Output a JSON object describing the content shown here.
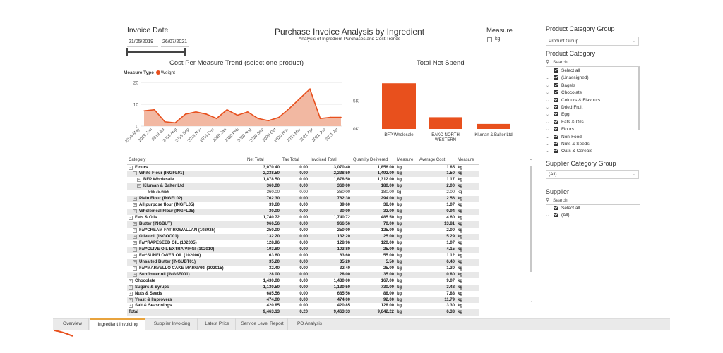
{
  "invoice_date": {
    "title": "Invoice Date",
    "start": "21/05/2019",
    "end": "26/07/2021"
  },
  "report": {
    "title": "Purchase Invoice Analysis by Ingredient",
    "subtitle": "Analysis of Ingredient Purchases and Cost Trends"
  },
  "measure": {
    "title": "Measure",
    "option": "kg"
  },
  "product_category_group": {
    "title": "Product Category Group",
    "selected": "Product Group"
  },
  "product_category": {
    "title": "Product Category",
    "search_placeholder": "Search",
    "select_all": "Select all",
    "items": [
      "(Unassigned)",
      "Bagels",
      "Chocolate",
      "Colours & Flavours",
      "Dried Fruit",
      "Egg",
      "Fats & Oils",
      "Flours",
      "Non-Food",
      "Nuts & Seeds",
      "Oats & Cereals"
    ]
  },
  "supplier_category_group": {
    "title": "Supplier Category Group",
    "selected": "(All)"
  },
  "supplier": {
    "title": "Supplier",
    "search_placeholder": "Search",
    "select_all": "Select all",
    "items": [
      "(All)"
    ]
  },
  "line_chart_meta": {
    "legend_label": "Measure Type",
    "legend_item": "Weight"
  },
  "chart_data": [
    {
      "type": "area",
      "title": "Cost Per Measure Trend (select one product)",
      "color": "#e8501d",
      "fill": "#f2b8a2",
      "ylim": [
        0,
        20
      ],
      "yticks": [
        "0",
        "10",
        "20"
      ],
      "x_labels": [
        "2019 May",
        "2019 Jun",
        "2019 Jul",
        "2019 Aug",
        "2019 Sep",
        "2019 Oct",
        "2019 Nov",
        "2019 Dec",
        "2020 Jan",
        "2020 Feb",
        "2020 Mar",
        "2020 Apr",
        "2020 May",
        "2020 Jun",
        "2020 Jul",
        "2020 Aug",
        "2020 Sep",
        "2020 Oct",
        "2020 Nov",
        "2020 Dec",
        "2021 Jan",
        "2021 Feb",
        "2021 Mar",
        "2021 Apr",
        "2021 May",
        "2021 Jun",
        "2021 Jul"
      ],
      "shown_tick_labels": [
        "2019 May",
        "2019 Jun",
        "2019 Jul",
        "2019 Aug",
        "2019 Sep",
        "2019 Nov",
        "2019 Dec",
        "2020 Jan",
        "2020 Feb",
        "2020 Aug",
        "2020 Sep",
        "2020 Oct",
        "2020 Nov",
        "2021 Mar",
        "2021 Apr",
        "2021 Jun",
        "2021 Jul"
      ],
      "values": [
        7,
        7.5,
        2,
        1.5,
        5.5,
        6.5,
        5.5,
        3.5,
        7.5,
        5,
        6.5,
        3.5,
        2.5,
        4,
        8,
        12.5,
        17,
        3.5,
        4,
        4
      ]
    },
    {
      "type": "bar",
      "title": "Total Net Spend",
      "color": "#e8501d",
      "categories": [
        "BFP Wholesale",
        "BAKO NORTH WESTERN",
        "Kluman & Balter Ltd"
      ],
      "values": [
        8.2,
        2.1,
        0.9
      ],
      "ylim": [
        0,
        10
      ],
      "yticks": [
        "0K",
        "5K"
      ],
      "category_lines": [
        [
          "BFP Wholesale"
        ],
        [
          "BAKO NORTH",
          "WESTERN"
        ],
        [
          "Kluman & Balter Ltd"
        ]
      ]
    }
  ],
  "table": {
    "headers": [
      "Category",
      "Net Total",
      "Tax Total",
      "Invoiced Total",
      "Quantity Delivered",
      "Measure",
      "Average Cost",
      "Measure"
    ],
    "rows": [
      {
        "level": 0,
        "box": "minus",
        "label": "Flours",
        "net": "3,070.40",
        "tax": "0.00",
        "inv": "3,070.40",
        "qty": "1,856.00",
        "m1": "kg",
        "avg": "1.85",
        "m2": "kg"
      },
      {
        "level": 1,
        "box": "minus",
        "label": "White Flour (INGFL01)",
        "net": "2,238.50",
        "tax": "0.00",
        "inv": "2,238.50",
        "qty": "1,492.00",
        "m1": "kg",
        "avg": "1.50",
        "m2": "kg"
      },
      {
        "level": 2,
        "box": "plus",
        "label": "BFP Wholesale",
        "net": "1,878.50",
        "tax": "0.00",
        "inv": "1,878.50",
        "qty": "1,312.00",
        "m1": "kg",
        "avg": "1.17",
        "m2": "kg"
      },
      {
        "level": 2,
        "box": "minus",
        "label": "Kluman & Balter Ltd",
        "net": "360.00",
        "tax": "0.00",
        "inv": "360.00",
        "qty": "180.00",
        "m1": "kg",
        "avg": "2.00",
        "m2": "kg"
      },
      {
        "level": 3,
        "box": "",
        "label": "565757656",
        "net": "360.00",
        "tax": "0.00",
        "inv": "360.00",
        "qty": "180.00",
        "m1": "kg",
        "avg": "2.00",
        "m2": "kg"
      },
      {
        "level": 1,
        "box": "plus",
        "label": "Plain Flour (INGFL02)",
        "net": "762.30",
        "tax": "0.00",
        "inv": "762.30",
        "qty": "294.00",
        "m1": "kg",
        "avg": "2.56",
        "m2": "kg"
      },
      {
        "level": 1,
        "box": "plus",
        "label": "All purpose flour (INGFL05)",
        "net": "39.60",
        "tax": "0.00",
        "inv": "39.60",
        "qty": "38.00",
        "m1": "kg",
        "avg": "1.07",
        "m2": "kg"
      },
      {
        "level": 1,
        "box": "plus",
        "label": "Wholemeal Flour (INGFL25)",
        "net": "30.00",
        "tax": "0.00",
        "inv": "30.00",
        "qty": "32.00",
        "m1": "kg",
        "avg": "0.94",
        "m2": "kg"
      },
      {
        "level": 0,
        "box": "minus",
        "label": "Fats & Oils",
        "net": "1,740.72",
        "tax": "0.00",
        "inv": "1,740.72",
        "qty": "485.50",
        "m1": "kg",
        "avg": "4.60",
        "m2": "kg"
      },
      {
        "level": 1,
        "box": "plus",
        "label": "Butter (INGBUT)",
        "net": "966.56",
        "tax": "0.00",
        "inv": "966.56",
        "qty": "70.00",
        "m1": "kg",
        "avg": "13.81",
        "m2": "kg"
      },
      {
        "level": 1,
        "box": "plus",
        "label": "Fat*CREAM FAT ROWALLAN (102025)",
        "net": "250.00",
        "tax": "0.00",
        "inv": "250.00",
        "qty": "125.00",
        "m1": "kg",
        "avg": "2.00",
        "m2": "kg"
      },
      {
        "level": 1,
        "box": "plus",
        "label": "Olive oil (INGOO01)",
        "net": "132.20",
        "tax": "0.00",
        "inv": "132.20",
        "qty": "25.00",
        "m1": "kg",
        "avg": "5.29",
        "m2": "kg"
      },
      {
        "level": 1,
        "box": "plus",
        "label": "Fat*RAPESEED OIL (102005)",
        "net": "128.96",
        "tax": "0.00",
        "inv": "128.96",
        "qty": "120.00",
        "m1": "kg",
        "avg": "1.07",
        "m2": "kg"
      },
      {
        "level": 1,
        "box": "plus",
        "label": "Fat*OLIVE OIL EXTRA VIRGI (102010)",
        "net": "103.80",
        "tax": "0.00",
        "inv": "103.80",
        "qty": "25.00",
        "m1": "kg",
        "avg": "4.15",
        "m2": "kg"
      },
      {
        "level": 1,
        "box": "plus",
        "label": "Fat*SUNFLOWER OIL (102006)",
        "net": "63.60",
        "tax": "0.00",
        "inv": "63.60",
        "qty": "55.00",
        "m1": "kg",
        "avg": "1.12",
        "m2": "kg"
      },
      {
        "level": 1,
        "box": "plus",
        "label": "Unsalted Butter (INGUBT01)",
        "net": "35.20",
        "tax": "0.00",
        "inv": "35.20",
        "qty": "5.50",
        "m1": "kg",
        "avg": "6.40",
        "m2": "kg"
      },
      {
        "level": 1,
        "box": "plus",
        "label": "Fat*MARVELLO CAKE MARGARI (102015)",
        "net": "32.40",
        "tax": "0.00",
        "inv": "32.40",
        "qty": "25.00",
        "m1": "kg",
        "avg": "1.30",
        "m2": "kg"
      },
      {
        "level": 1,
        "box": "plus",
        "label": "Sunflower oil (INGSF001)",
        "net": "28.00",
        "tax": "0.00",
        "inv": "28.00",
        "qty": "35.00",
        "m1": "kg",
        "avg": "0.80",
        "m2": "kg"
      },
      {
        "level": 0,
        "box": "plus",
        "label": "Chocolate",
        "net": "1,430.00",
        "tax": "0.00",
        "inv": "1,430.00",
        "qty": "167.00",
        "m1": "kg",
        "avg": "9.07",
        "m2": "kg"
      },
      {
        "level": 0,
        "box": "plus",
        "label": "Sugars & Syrups",
        "net": "1,130.50",
        "tax": "0.00",
        "inv": "1,130.50",
        "qty": "730.00",
        "m1": "kg",
        "avg": "3.48",
        "m2": "kg"
      },
      {
        "level": 0,
        "box": "plus",
        "label": "Nuts & Seeds",
        "net": "685.56",
        "tax": "0.00",
        "inv": "685.56",
        "qty": "88.00",
        "m1": "kg",
        "avg": "7.88",
        "m2": "kg"
      },
      {
        "level": 0,
        "box": "plus",
        "label": "Yeast & Improvers",
        "net": "474.00",
        "tax": "0.00",
        "inv": "474.00",
        "qty": "92.00",
        "m1": "kg",
        "avg": "11.79",
        "m2": "kg"
      },
      {
        "level": 0,
        "box": "plus",
        "label": "Salt & Seasonings",
        "net": "420.85",
        "tax": "0.00",
        "inv": "420.85",
        "qty": "128.00",
        "m1": "kg",
        "avg": "3.30",
        "m2": "kg"
      },
      {
        "level": 0,
        "box": "",
        "label": "Total",
        "net": "9,463.13",
        "tax": "0.20",
        "inv": "9,463.33",
        "qty": "9,642.22",
        "m1": "kg",
        "avg": "6.33",
        "m2": "kg"
      }
    ]
  },
  "tabs": [
    "Overview",
    "Ingredient Invoicing",
    "Supplier Invoicing",
    "Latest Price",
    "Service Level Report",
    "PO Analysis"
  ],
  "active_tab": 1
}
